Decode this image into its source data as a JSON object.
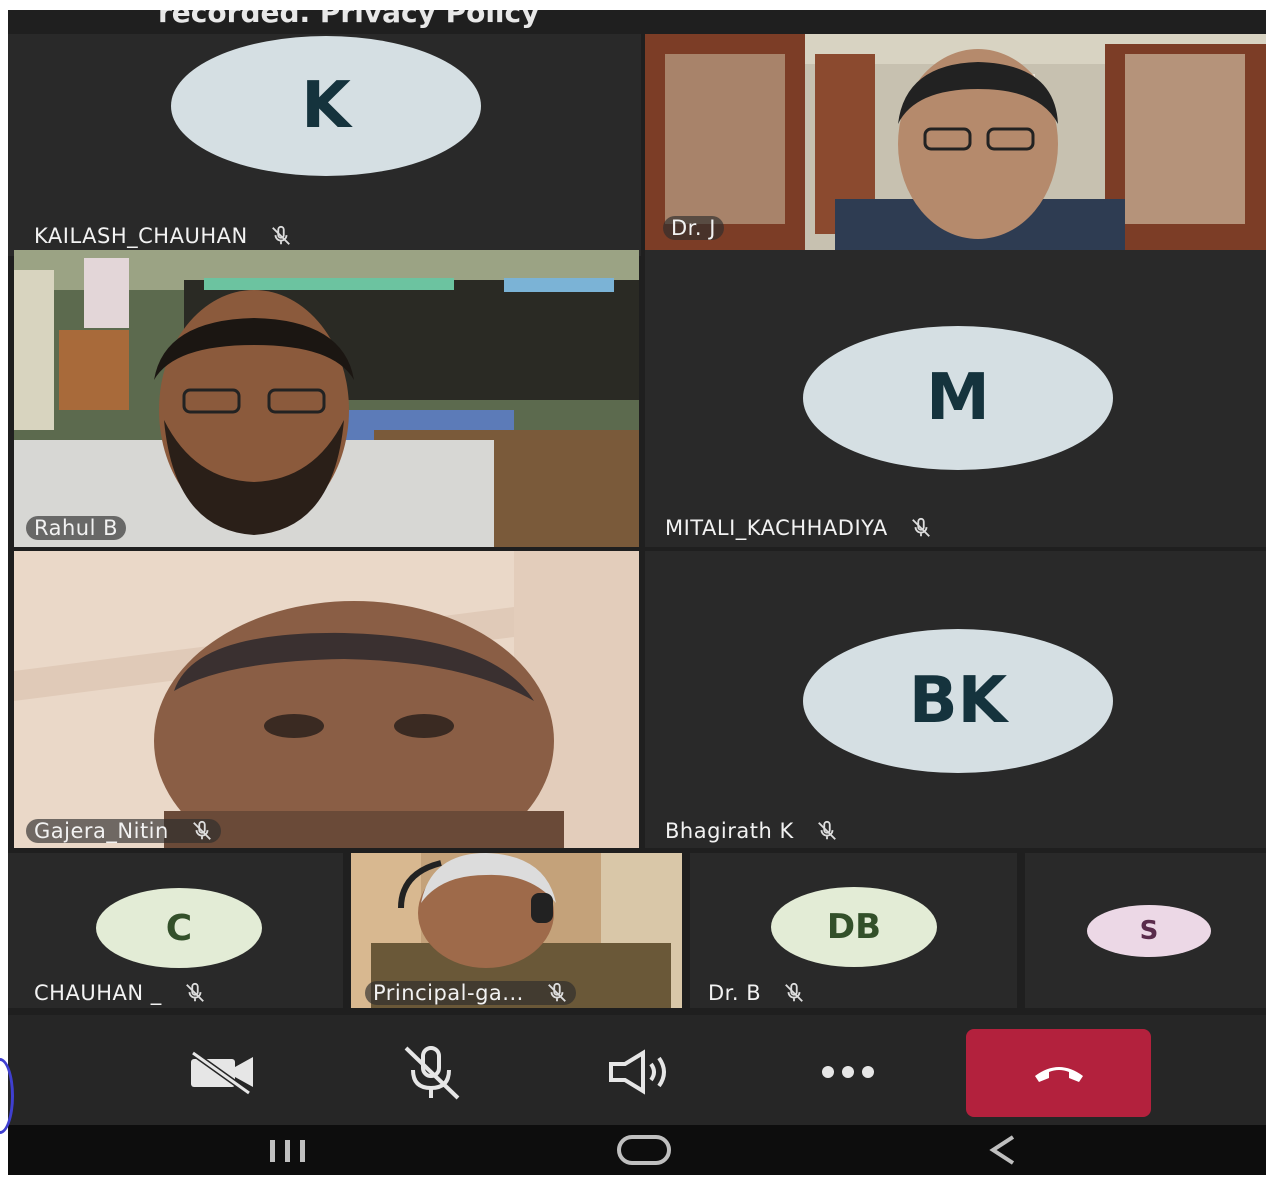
{
  "banner_text": "recorded. Privacy Policy",
  "participants": [
    {
      "name": "KAILASH_CHAUHAN",
      "initials": "K",
      "avatar_color": "#d5dfe3",
      "muted": true
    },
    {
      "name": "Dr. J",
      "video": true,
      "muted": false
    },
    {
      "name": "Rahul B",
      "video": true,
      "muted": false
    },
    {
      "name": "MITALI_KACHHADIYA",
      "initials": "M",
      "avatar_color": "#d5dfe3",
      "muted": true
    },
    {
      "name": "Gajera_Nitin",
      "video": true,
      "muted": true
    },
    {
      "name": "Bhagirath K",
      "initials": "BK",
      "avatar_color": "#d5dfe3",
      "muted": true
    },
    {
      "name": "CHAUHAN _",
      "initials": "C",
      "avatar_color": "#e3ecd6",
      "muted": true
    },
    {
      "name": "Principal-ga...",
      "video": true,
      "muted": true
    },
    {
      "name": "Dr. B",
      "initials": "DB",
      "avatar_color": "#e3ecd6",
      "muted": true
    },
    {
      "name": "",
      "initials": "S",
      "avatar_color": "#ecd8e6",
      "muted": false
    }
  ],
  "controls": [
    {
      "name": "camera-off-icon"
    },
    {
      "name": "mic-off-icon"
    },
    {
      "name": "speaker-icon"
    },
    {
      "name": "more-icon"
    },
    {
      "name": "end-call-icon",
      "color": "#b3213d"
    }
  ],
  "nav": [
    {
      "name": "recents-icon"
    },
    {
      "name": "home-icon"
    },
    {
      "name": "back-icon"
    }
  ],
  "colors": {
    "background": "#1f1f1f",
    "tile": "#292929",
    "end_call": "#b3213d"
  }
}
